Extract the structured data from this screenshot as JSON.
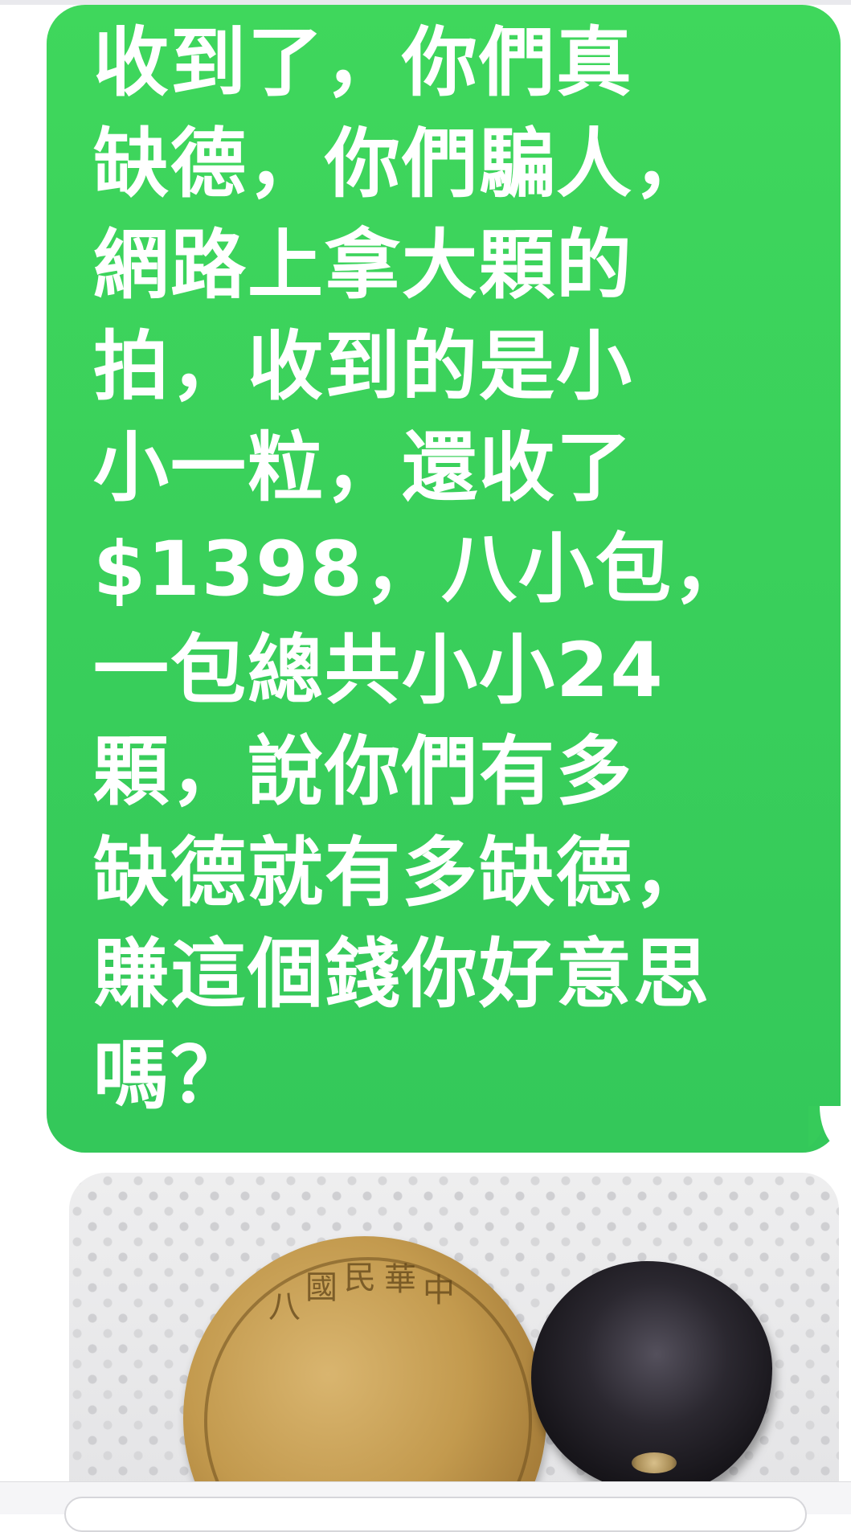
{
  "message": {
    "text": "收到了，你們真缺德，你們騙人，網路上拿大顆的拍，收到的是小小一粒，還收了$1398，八小包，一包總共小小24顆，說你們有多缺德就有多缺德，賺這個錢你好意思嗎？",
    "lines": [
      "收到了，你們真",
      "缺德，你們騙人，",
      "網路上拿大顆的",
      "拍，收到的是小",
      "小一粒，還收了",
      "$1398，八小包，",
      "一包總共小小24",
      "顆，說你們有多",
      "缺德就有多缺德，",
      "賺這個錢你好意思",
      "嗎？"
    ],
    "bubble_color": "#34c85a",
    "text_color": "#ffffff"
  },
  "photo": {
    "coin_lettering": [
      "中",
      "華",
      "民",
      "國",
      "八"
    ]
  }
}
